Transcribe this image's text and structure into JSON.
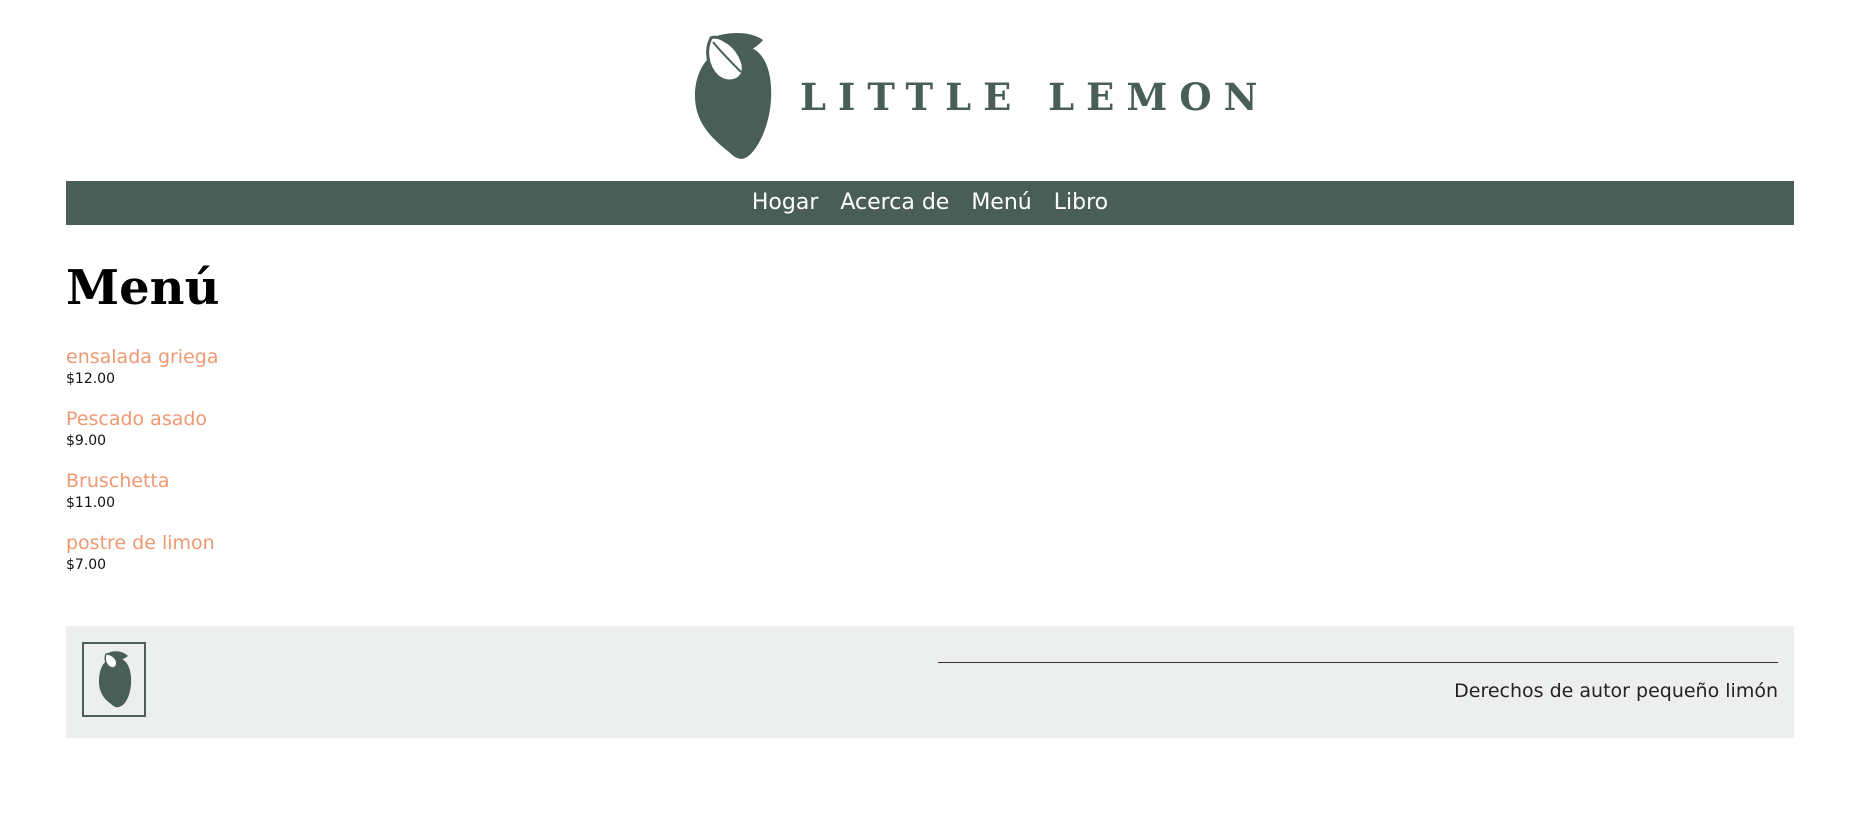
{
  "brand": {
    "name": "LITTLE LEMON",
    "color": "#495e57"
  },
  "nav": {
    "items": [
      {
        "label": "Hogar"
      },
      {
        "label": "Acerca de"
      },
      {
        "label": "Menú"
      },
      {
        "label": "Libro"
      }
    ]
  },
  "main": {
    "title": "Menú",
    "items": [
      {
        "name": "ensalada griega",
        "price": "$12.00"
      },
      {
        "name": "Pescado asado",
        "price": "$9.00"
      },
      {
        "name": "Bruschetta",
        "price": "$11.00"
      },
      {
        "name": "postre de limon",
        "price": "$7.00"
      }
    ]
  },
  "footer": {
    "copyright": "Derechos de autor pequeño limón"
  },
  "colors": {
    "accent": "#ee9972",
    "footer_bg": "#edefee",
    "nav_bg": "#495e57"
  },
  "icons": {
    "logo": "lemon-logo-icon",
    "footer_logo": "lemon-footer-logo-icon"
  }
}
